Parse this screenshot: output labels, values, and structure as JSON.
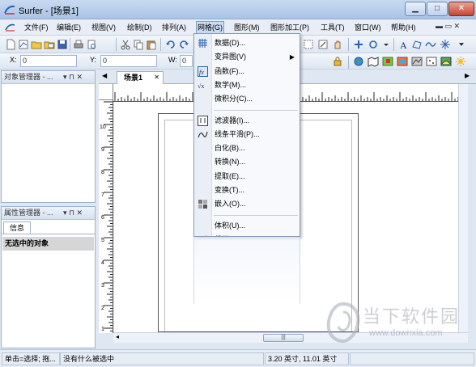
{
  "window": {
    "title": "Surfer - [场景1]",
    "controls": {
      "minimize": "▁",
      "maximize": "□",
      "close": "✕"
    }
  },
  "menubar": {
    "items": [
      "文件(F)",
      "编辑(E)",
      "视图(V)",
      "绘制(D)",
      "排列(A)",
      "网格(G)",
      "图形(M)",
      "图形加工(P)",
      "工具(T)",
      "窗口(W)",
      "帮助(H)"
    ],
    "active_index": 5,
    "mdi_controls": "▬ ▭ ✕"
  },
  "toolbar2": {
    "x_label": "X:",
    "x_value": "0",
    "y_label": "Y:",
    "y_value": "0",
    "w_label": "W:",
    "w_value": "0"
  },
  "object_manager": {
    "title": "对象管理器 - ...",
    "controls": "▾ ⊓ ✕"
  },
  "property_manager": {
    "title": "属性管理器 - ...",
    "controls": "▾ ⊓ ✕",
    "tab": "信息",
    "content": "无选中的对象"
  },
  "document": {
    "tab_label": "场景1",
    "tab_close": "✕",
    "nav_left": "◀",
    "nav_right": "▶"
  },
  "rulers": {
    "h_labels": [
      "",
      "",
      "",
      "",
      "",
      "",
      "",
      "",
      ""
    ],
    "v_labels": [
      "10",
      "9",
      "8",
      "7",
      "6",
      "5",
      "4",
      "3",
      "2",
      "1"
    ]
  },
  "grid_menu": {
    "items": [
      {
        "label": "数据(D)...",
        "icon": "grid-data-icon"
      },
      {
        "label": "变异图(V)",
        "icon": "",
        "submenu": true
      },
      {
        "label": "函数(F)...",
        "icon": "function-icon"
      },
      {
        "label": "数学(M)...",
        "icon": "math-icon"
      },
      {
        "label": "微积分(C)...",
        "icon": ""
      },
      {
        "label": "滤波器(I)...",
        "icon": "filter-icon",
        "separator_before": true
      },
      {
        "label": "线条平滑(P)...",
        "icon": "smooth-icon"
      },
      {
        "label": "白化(B)...",
        "icon": ""
      },
      {
        "label": "转换(N)...",
        "icon": ""
      },
      {
        "label": "提取(E)...",
        "icon": ""
      },
      {
        "label": "变换(T)...",
        "icon": ""
      },
      {
        "label": "嵌入(O)...",
        "icon": "mosaic-icon"
      },
      {
        "label": "体积(U)...",
        "icon": "",
        "separator_before": true
      },
      {
        "label": "截面(S)...",
        "icon": "slice-icon"
      }
    ],
    "submenu_arrow": "▶"
  },
  "statusbar": {
    "hint": "单击=选择; 拖...",
    "selection": "没有什么被选中",
    "position": "3.20 英寸, 11.01 英寸"
  },
  "scroll": {
    "thumb_grip": "|||"
  },
  "watermark": {
    "title": "当下软件园",
    "url": "www.downxia.com"
  },
  "colors": {
    "accent": "#c9dcf3",
    "titlebar": "#a9c4e6",
    "close": "#c8452f"
  }
}
